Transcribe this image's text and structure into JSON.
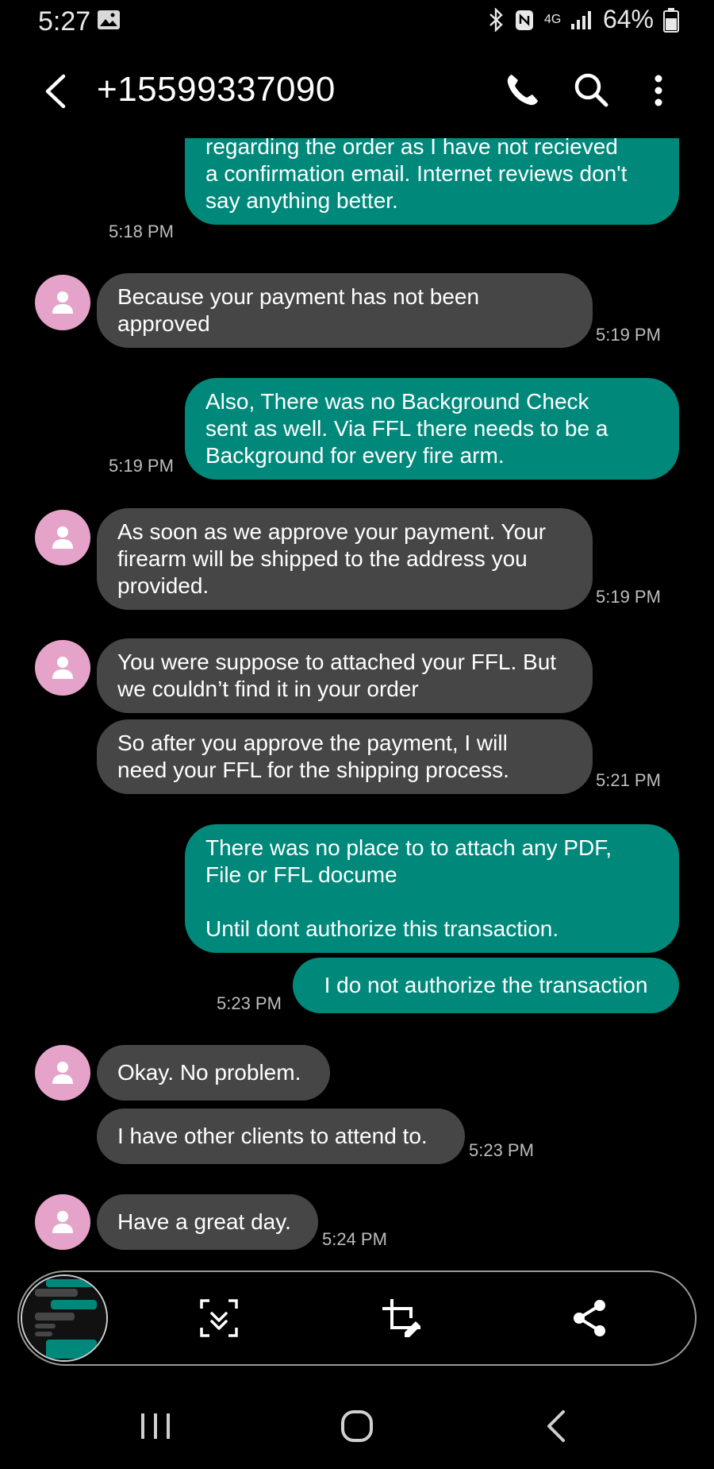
{
  "status": {
    "time": "5:27",
    "network": "4G",
    "battery": "64%"
  },
  "header": {
    "contact": "+15599337090"
  },
  "messages": [
    {
      "dir": "out",
      "text": "out by phone and email numerous times,\nregarding the order as I have not recieved\na confirmation email. Internet reviews don't\nsay anything better.",
      "time": "5:18 PM"
    },
    {
      "dir": "in",
      "text": "Because your payment has not been\napproved",
      "time": "5:19 PM"
    },
    {
      "dir": "out",
      "text": "Also, There was no Background Check\nsent as well. Via FFL there needs to be a\nBackground for every fire arm.",
      "time": "5:19 PM"
    },
    {
      "dir": "in",
      "text": "As soon as we approve your payment. Your\nfirearm will be shipped to the address you\nprovided.",
      "time": "5:19 PM"
    },
    {
      "dir": "in",
      "text": "You were suppose to attached your FFL. But\nwe couldn’t find it in your order",
      "time": ""
    },
    {
      "dir": "in",
      "text": "So after you approve the payment, I will\nneed your FFL for the shipping process.",
      "time": "5:21 PM"
    },
    {
      "dir": "out",
      "text": "There was no place to to attach any PDF,\nFile or FFL docume\n\n Until dont authorize this transaction.",
      "time": ""
    },
    {
      "dir": "out",
      "text": "I do not authorize the transaction",
      "time": "5:23 PM"
    },
    {
      "dir": "in",
      "text": "Okay. No problem.",
      "time": ""
    },
    {
      "dir": "in",
      "text": "I have other clients to attend to.",
      "time": "5:23 PM"
    },
    {
      "dir": "in",
      "text": "Have a great day.",
      "time": "5:24 PM"
    }
  ],
  "toolbar": {
    "items": [
      "screenshot-thumbnail",
      "scroll-capture-icon",
      "crop-edit-icon",
      "share-icon"
    ]
  },
  "colors": {
    "outgoing": "#00897b",
    "incoming": "#464646",
    "avatar": "#e6a3c9"
  }
}
